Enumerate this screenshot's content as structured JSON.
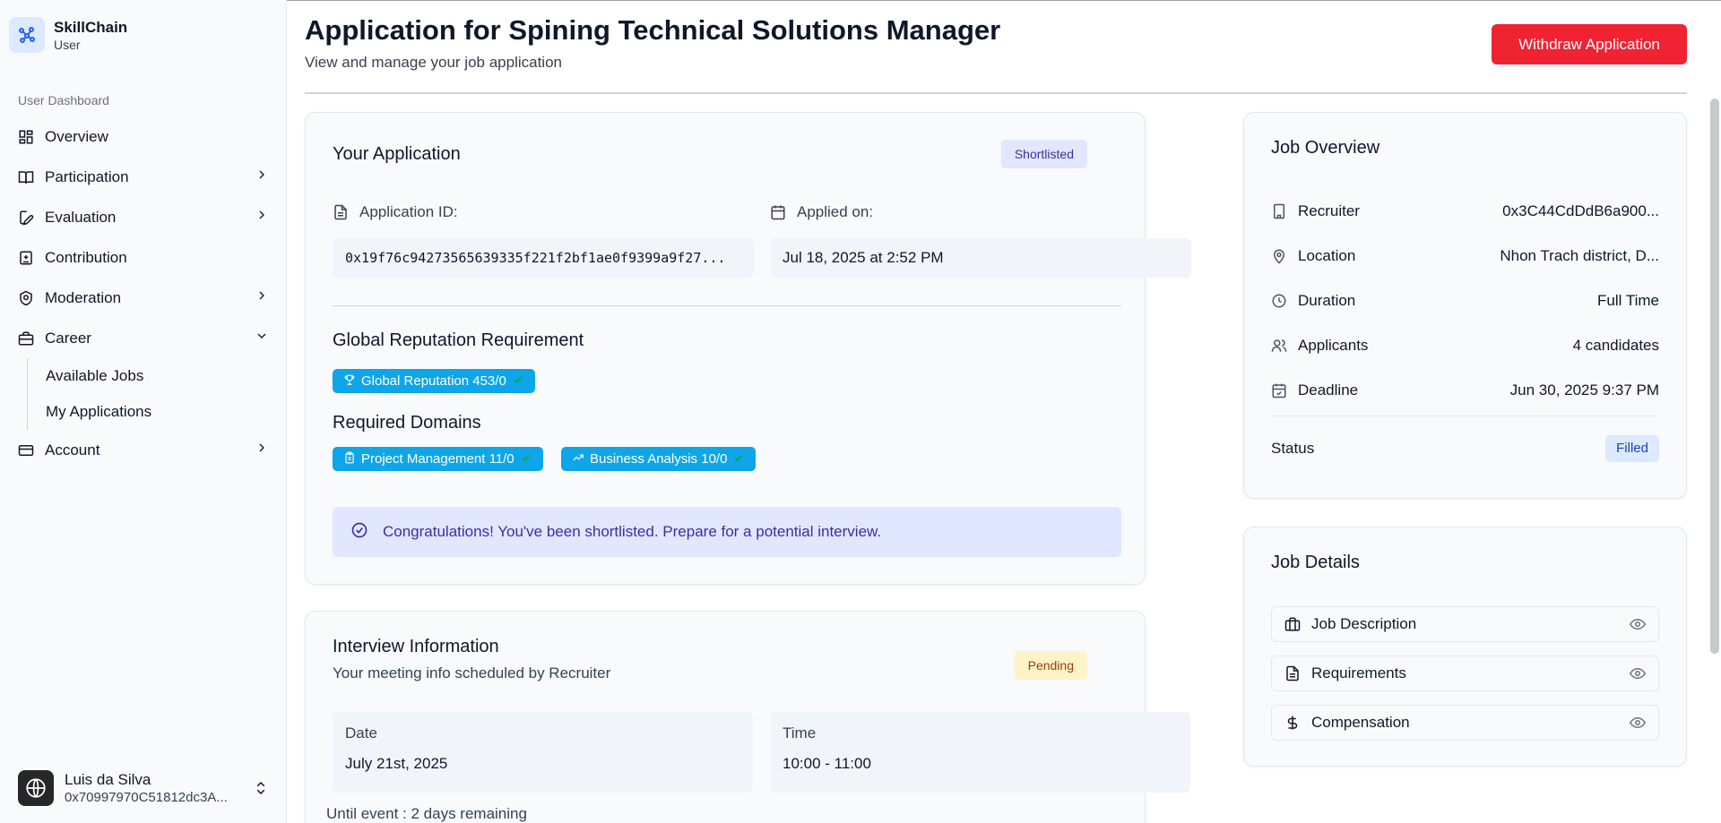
{
  "sidebar": {
    "brand_name": "SkillChain",
    "brand_role": "User",
    "section_heading": "User Dashboard",
    "items": {
      "overview": "Overview",
      "participation": "Participation",
      "evaluation": "Evaluation",
      "contribution": "Contribution",
      "moderation": "Moderation",
      "career": "Career",
      "available_jobs": "Available Jobs",
      "my_applications": "My Applications",
      "account": "Account"
    },
    "user": {
      "name": "Luis da Silva",
      "address": "0x70997970C51812dc3A..."
    }
  },
  "header": {
    "title": "Application for Spining Technical Solutions Manager",
    "subtitle": "View and manage your job application",
    "withdraw_label": "Withdraw Application"
  },
  "application": {
    "title": "Your Application",
    "status": "Shortlisted",
    "app_id_label": "Application ID:",
    "app_id_value": "0x19f76c94273565639335f221f2bf1ae0f9399a9f27...",
    "applied_label": "Applied on:",
    "applied_value": "Jul 18, 2025 at 2:52 PM",
    "global_rep_heading": "Global Reputation Requirement",
    "global_rep_chip": "Global Reputation 453/0",
    "domains_heading": "Required Domains",
    "domains": [
      "Project Management 11/0",
      "Business Analysis 10/0"
    ],
    "alert": "Congratulations! You've been shortlisted. Prepare for a potential interview."
  },
  "interview": {
    "title": "Interview Information",
    "subtitle": "Your meeting info scheduled by Recruiter",
    "status": "Pending",
    "date_label": "Date",
    "date_value": "July 21st, 2025",
    "time_label": "Time",
    "time_value": "10:00 - 11:00",
    "until": "Until event : 2 days remaining"
  },
  "overview": {
    "title": "Job Overview",
    "recruiter_label": "Recruiter",
    "recruiter_value": "0x3C44CdDdB6a900...",
    "location_label": "Location",
    "location_value": "Nhon Trach district, D...",
    "duration_label": "Duration",
    "duration_value": "Full Time",
    "applicants_label": "Applicants",
    "applicants_value": "4 candidates",
    "deadline_label": "Deadline",
    "deadline_value": "Jun 30, 2025 9:37 PM",
    "status_label": "Status",
    "status_value": "Filled"
  },
  "details": {
    "title": "Job Details",
    "items": [
      "Job Description",
      "Requirements",
      "Compensation"
    ]
  },
  "colors": {
    "withdraw_bg": "#ef2332",
    "chip_bg": "#0ea5e9",
    "shortlisted_bg": "#e0e7ff",
    "shortlisted_fg": "#3730a3",
    "pending_bg": "#fef3c7",
    "pending_fg": "#92400e",
    "filled_bg": "#dbeafe",
    "filled_fg": "#1e40af"
  }
}
